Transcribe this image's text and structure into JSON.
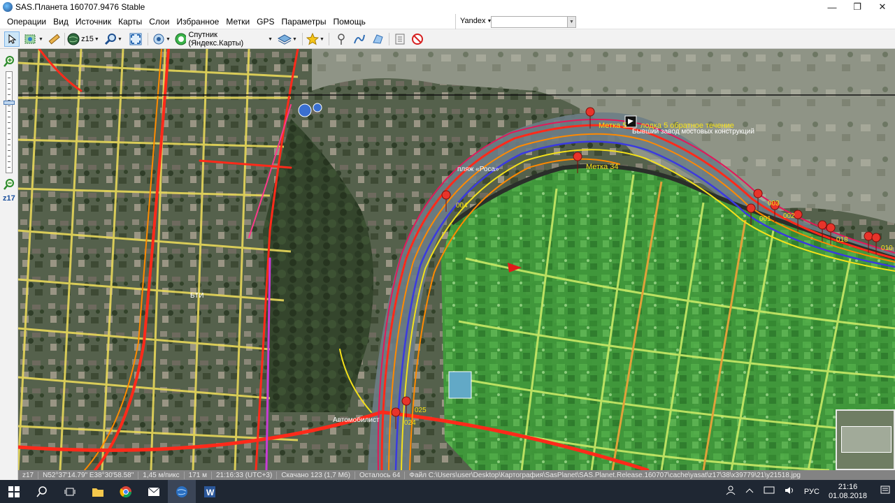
{
  "window": {
    "title": "SAS.Планета 160707.9476 Stable"
  },
  "menu": {
    "items": [
      "Операции",
      "Вид",
      "Источник",
      "Карты",
      "Слои",
      "Избранное",
      "Метки",
      "GPS",
      "Параметры",
      "Помощь"
    ],
    "source": "Yandex"
  },
  "toolbar": {
    "zoom_level": "z15",
    "map_type": "Спутник (Яндекс.Карты)"
  },
  "left_panel": {
    "zoom_level": "z17"
  },
  "map": {
    "labels": {
      "placemark_5": "Метка 5",
      "boat_label": "лодка 5 обратное течение",
      "factory": "Бывший завод мостовых конструкций",
      "placemark_34": "Метка 34",
      "beach": "пляж «Роса»",
      "p004": "004",
      "p003": "003",
      "p001": "001",
      "p002": "002",
      "p018": "018",
      "p010": "010",
      "p025": "025",
      "p024": "024",
      "bti": "БТИ",
      "avtomobil": "Автомобилист"
    }
  },
  "status": {
    "zoom": "z17",
    "coords": "N52°37'14.79\" E38°30'58.58\"",
    "scale": "1,45 м/пикс",
    "distance": "171 м",
    "time": "21:16:33 (UTC+3)",
    "downloaded": "Скачано 123 (1,7 Мб)",
    "remaining": "Осталось 64",
    "file": "Файл C:\\Users\\user\\Desktop\\Картография\\SasPlanet\\SAS.Planet.Release.160707\\cache\\yasat\\z17\\38\\x39779\\21\\y21518.jpg"
  },
  "taskbar": {
    "lang": "РУС",
    "time": "21:16",
    "date": "01.08.2018"
  }
}
